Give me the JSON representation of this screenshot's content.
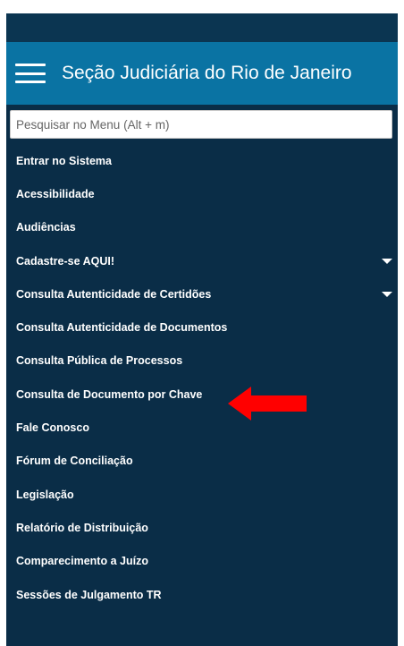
{
  "header": {
    "title": "Seção Judiciária do Rio de Janeiro",
    "menu_icon": "hamburger-menu-icon"
  },
  "search": {
    "placeholder": "Pesquisar no Menu (Alt + m)",
    "value": ""
  },
  "menu": {
    "items": [
      {
        "label": "Entrar no Sistema",
        "has_submenu": false
      },
      {
        "label": "Acessibilidade",
        "has_submenu": false
      },
      {
        "label": "Audiências",
        "has_submenu": false
      },
      {
        "label": "Cadastre-se AQUI!",
        "has_submenu": true
      },
      {
        "label": "Consulta Autenticidade de Certidões",
        "has_submenu": true
      },
      {
        "label": "Consulta Autenticidade de Documentos",
        "has_submenu": false
      },
      {
        "label": "Consulta Pública de Processos",
        "has_submenu": false
      },
      {
        "label": "Consulta de Documento por Chave",
        "has_submenu": false
      },
      {
        "label": "Fale Conosco",
        "has_submenu": false
      },
      {
        "label": "Fórum de Conciliação",
        "has_submenu": false
      },
      {
        "label": "Legislação",
        "has_submenu": false
      },
      {
        "label": "Relatório de Distribuição",
        "has_submenu": false
      },
      {
        "label": "Comparecimento a Juízo",
        "has_submenu": false
      },
      {
        "label": "Sessões de Julgamento TR",
        "has_submenu": false
      }
    ]
  },
  "colors": {
    "panel_bg": "#0a2d47",
    "header_bg": "#0a73a3",
    "topbar_bg": "#0b3551",
    "text": "#ffffff",
    "arrow": "#ff0000"
  }
}
